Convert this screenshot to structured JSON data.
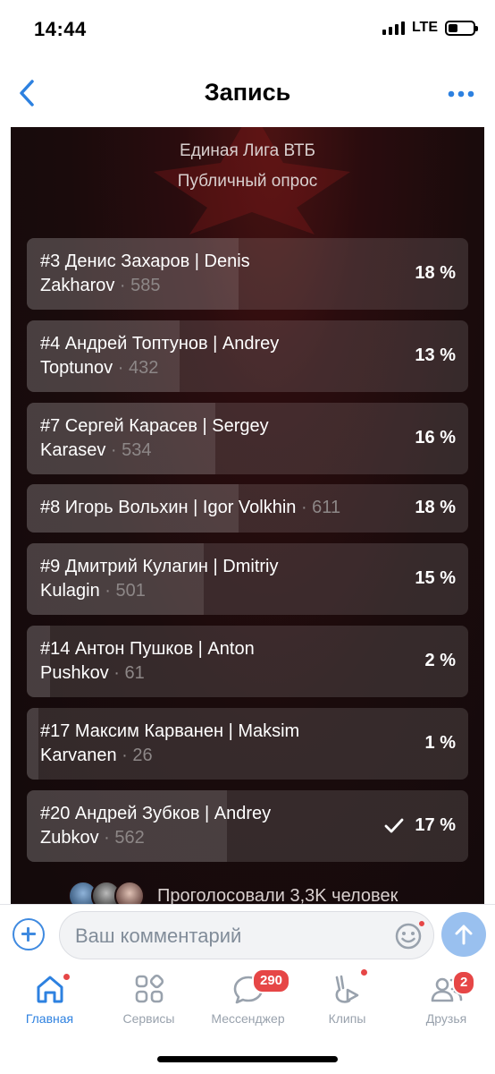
{
  "status_bar": {
    "time": "14:44",
    "network": "LTE",
    "battery_level": 0.4
  },
  "nav": {
    "title": "Запись",
    "back_icon": "chevron-left-icon",
    "more_icon": "ellipsis-icon"
  },
  "poll": {
    "title": "Единая Лига ВТБ",
    "subtitle": "Публичный опрос",
    "options": [
      {
        "line1": "#3 Денис Захаров | Denis",
        "line2": "Zakharov",
        "count": " · 585",
        "percent": "18 %",
        "fraction": 0.18,
        "checked": false
      },
      {
        "line1": "#4 Андрей Топтунов | Andrey",
        "line2": "Toptunov",
        "count": " · 432",
        "percent": "13 %",
        "fraction": 0.13,
        "checked": false
      },
      {
        "line1": "#7 Сергей Карасев | Sergey",
        "line2": "Karasev",
        "count": " · 534",
        "percent": "16 %",
        "fraction": 0.16,
        "checked": false
      },
      {
        "line1": "#8 Игорь Вольхин | Igor Volkhin",
        "line2": "",
        "count": " · 611",
        "percent": "18 %",
        "fraction": 0.18,
        "checked": false
      },
      {
        "line1": "#9 Дмитрий Кулагин | Dmitriy",
        "line2": "Kulagin",
        "count": " · 501",
        "percent": "15 %",
        "fraction": 0.15,
        "checked": false
      },
      {
        "line1": "#14 Антон Пушков | Anton",
        "line2": "Pushkov",
        "count": " · 61",
        "percent": "2 %",
        "fraction": 0.02,
        "checked": false
      },
      {
        "line1": "#17 Максим Карванен | Maksim",
        "line2": "Karvanen",
        "count": " · 26",
        "percent": "1 %",
        "fraction": 0.01,
        "checked": false
      },
      {
        "line1": "#20 Андрей Зубков | Andrey",
        "line2": "Zubkov",
        "count": " · 562",
        "percent": "17 %",
        "fraction": 0.17,
        "checked": true
      }
    ],
    "voters_text": "Проголосовали 3,3K человек"
  },
  "comment": {
    "placeholder": "Ваш комментарий"
  },
  "tabs": [
    {
      "label": "Главная",
      "icon": "home-icon",
      "active": true,
      "dot": true,
      "badge": ""
    },
    {
      "label": "Сервисы",
      "icon": "services-icon",
      "active": false,
      "dot": false,
      "badge": ""
    },
    {
      "label": "Мессенджер",
      "icon": "messenger-icon",
      "active": false,
      "dot": false,
      "badge": "290"
    },
    {
      "label": "Клипы",
      "icon": "clips-icon",
      "active": false,
      "dot": true,
      "badge": ""
    },
    {
      "label": "Друзья",
      "icon": "friends-icon",
      "active": false,
      "dot": false,
      "badge": "2"
    }
  ],
  "colors": {
    "accent": "#2d81e0",
    "badge": "#e64646",
    "poll_bg": "#130a0b"
  }
}
